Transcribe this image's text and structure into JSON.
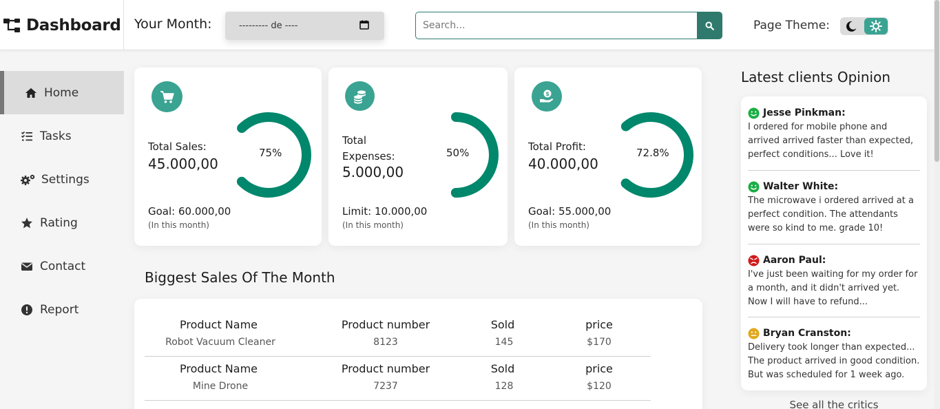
{
  "header": {
    "brand_title": "Dashboard",
    "month_label": "Your Month:",
    "month_value": "--------- de ----",
    "search_placeholder": "Search...",
    "theme_label": "Page Theme:"
  },
  "sidebar": {
    "items": [
      {
        "label": "Home",
        "icon": "home-icon",
        "active": true
      },
      {
        "label": "Tasks",
        "icon": "tasks-icon"
      },
      {
        "label": "Settings",
        "icon": "settings-icon"
      },
      {
        "label": "Rating",
        "icon": "star-icon"
      },
      {
        "label": "Contact",
        "icon": "envelope-icon"
      },
      {
        "label": "Report",
        "icon": "alert-icon"
      }
    ]
  },
  "cards": [
    {
      "title": "Total Sales:",
      "value": "45.000,00",
      "goal": "Goal: 60.000,00",
      "sub": "(In this month)",
      "percent_label": "75%",
      "percent": 75,
      "icon": "cart-icon"
    },
    {
      "title": "Total Expenses:",
      "value": "5.000,00",
      "goal": "Limit: 10.000,00",
      "sub": "(In this month)",
      "percent_label": "50%",
      "percent": 50,
      "icon": "coins-icon"
    },
    {
      "title": "Total Profit:",
      "value": "40.000,00",
      "goal": "Goal: 55.000,00",
      "sub": "(In this month)",
      "percent_label": "72.8%",
      "percent": 72.8,
      "icon": "money-hand-icon"
    }
  ],
  "colors": {
    "accent": "#00876c",
    "accent_light": "#3aa392"
  },
  "sales": {
    "title": "Biggest Sales Of The Month",
    "rows": [
      {
        "h_name": "Product Name",
        "h_number": "Product number",
        "h_sold": "Sold",
        "h_price": "price",
        "name": "Robot Vacuum Cleaner",
        "number": "8123",
        "sold": "145",
        "price": "$170"
      },
      {
        "h_name": "Product Name",
        "h_number": "Product number",
        "h_sold": "Sold",
        "h_price": "price",
        "name": "Mine Drone",
        "number": "7237",
        "sold": "128",
        "price": "$120"
      }
    ]
  },
  "opinions": {
    "title": "Latest clients Opinion",
    "see_all": "See all the critics",
    "items": [
      {
        "name": "Jesse Pinkman:",
        "mood": "happy",
        "text": "I ordered for mobile phone and arrived arrived faster than expected, perfect conditions... Love it!"
      },
      {
        "name": "Walter White:",
        "mood": "happy",
        "text": "The microwave i ordered arrived at a perfect condition. The attendants were so kind to me. grade 10!"
      },
      {
        "name": "Aaron Paul:",
        "mood": "angry",
        "text": "I've just been waiting for my order for a month, and it didn't arrived yet. Now I will have to refund..."
      },
      {
        "name": "Bryan Cranston:",
        "mood": "neutral",
        "text": "Delivery took longer than expected... The product arrived in good condition. But was scheduled for 1 week ago."
      }
    ]
  }
}
